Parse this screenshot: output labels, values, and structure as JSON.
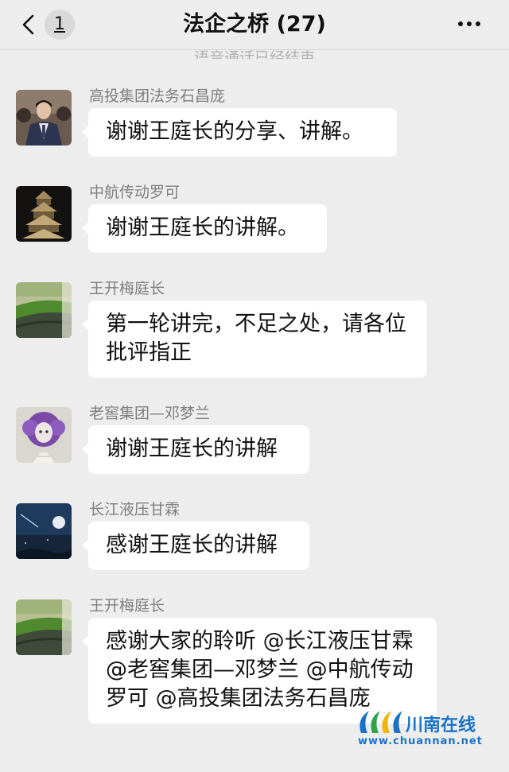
{
  "header": {
    "unread_count": "1",
    "title": "法企之桥 (27)"
  },
  "system_note": "语音通话已经结束",
  "messages": [
    {
      "sender": "高投集团法务石昌庞",
      "text": "谢谢王庭长的分享、讲解。",
      "avatar": "man-in-suit-photo"
    },
    {
      "sender": "中航传动罗可",
      "text": "谢谢王庭长的讲解。",
      "avatar": "pagoda-photo"
    },
    {
      "sender": "王开梅庭长",
      "text": "第一轮讲完，不足之处，请各位批评指正",
      "avatar": "moss-stone-photo"
    },
    {
      "sender": "老窖集团—邓梦兰",
      "text": "谢谢王庭长的讲解",
      "avatar": "purple-hair-girl-illustration"
    },
    {
      "sender": "长江液压甘霖",
      "text": "感谢王庭长的讲解",
      "avatar": "night-sky-moon-photo"
    },
    {
      "sender": "王开梅庭长",
      "text": "感谢大家的聆听 @长江液压甘霖 @老窖集团—邓梦兰 @中航传动罗可 @高投集团法务石昌庞",
      "avatar": "moss-stone-photo"
    }
  ],
  "watermark": {
    "name": "川南在线",
    "url": "www.chuannan.net"
  },
  "colors": {
    "background": "#ededed",
    "bubble": "#ffffff",
    "sender_text": "#7f7f7f",
    "watermark": "#1a73c9"
  }
}
